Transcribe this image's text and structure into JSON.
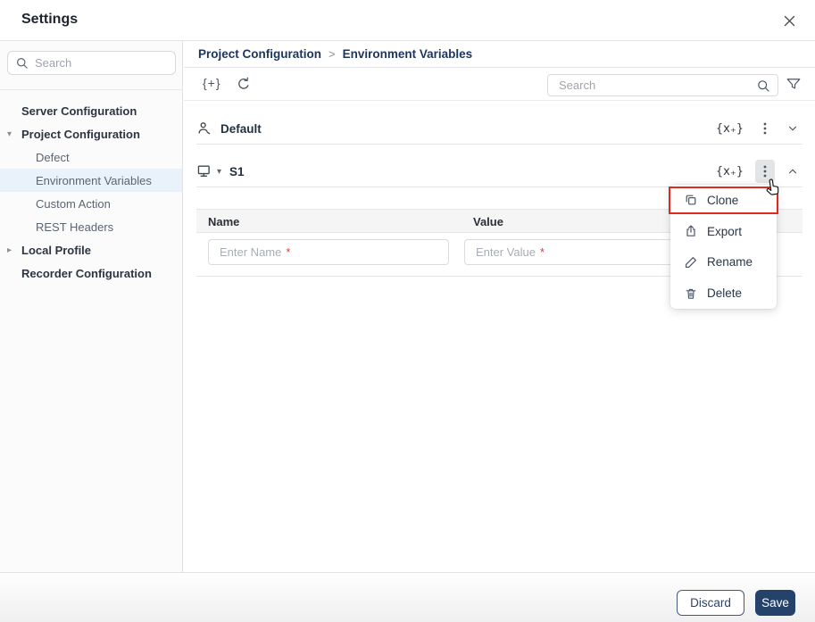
{
  "window": {
    "title": "Settings"
  },
  "sidebar": {
    "search": {
      "placeholder": "Search"
    },
    "items": [
      {
        "label": "Server Configuration",
        "type": "section",
        "state": "none"
      },
      {
        "label": "Project Configuration",
        "type": "section",
        "state": "expanded"
      },
      {
        "label": "Defect",
        "type": "child",
        "selected": false
      },
      {
        "label": "Environment Variables",
        "type": "child",
        "selected": true
      },
      {
        "label": "Custom Action",
        "type": "child",
        "selected": false
      },
      {
        "label": "REST Headers",
        "type": "child",
        "selected": false
      },
      {
        "label": "Local Profile",
        "type": "section",
        "state": "collapsed"
      },
      {
        "label": "Recorder Configuration",
        "type": "section",
        "state": "none"
      }
    ]
  },
  "main": {
    "breadcrumb": {
      "items": [
        "Project Configuration",
        "Environment Variables"
      ],
      "separator": ">"
    },
    "toolbar": {
      "search_placeholder": "Search"
    },
    "groups": [
      {
        "name": "Default",
        "collapsed": true
      },
      {
        "name": "S1",
        "collapsed": false
      }
    ],
    "table": {
      "columns": [
        "Name",
        "Value"
      ],
      "new_row": {
        "name_placeholder": "Enter Name",
        "value_placeholder": "Enter Value",
        "required_marker": "*"
      }
    },
    "context_menu": {
      "items": [
        {
          "label": "Clone",
          "highlighted": true
        },
        {
          "label": "Export",
          "highlighted": false
        },
        {
          "label": "Rename",
          "highlighted": false
        },
        {
          "label": "Delete",
          "highlighted": false
        }
      ]
    }
  },
  "icons": {
    "add_variable_glyph": "{+}",
    "variables_glyph": "{x₊}",
    "caret_down": "▾",
    "caret_right": "▸"
  },
  "footer": {
    "discard_label": "Discard",
    "save_label": "Save"
  },
  "colors": {
    "accent_navy": "#25426b",
    "breadcrumb_navy": "#1c355d",
    "highlight_red": "#e02a1f",
    "selected_item_bg": "#e9f1fb",
    "required_red": "#e5383b",
    "table_header_bg": "#f5f5f6"
  }
}
